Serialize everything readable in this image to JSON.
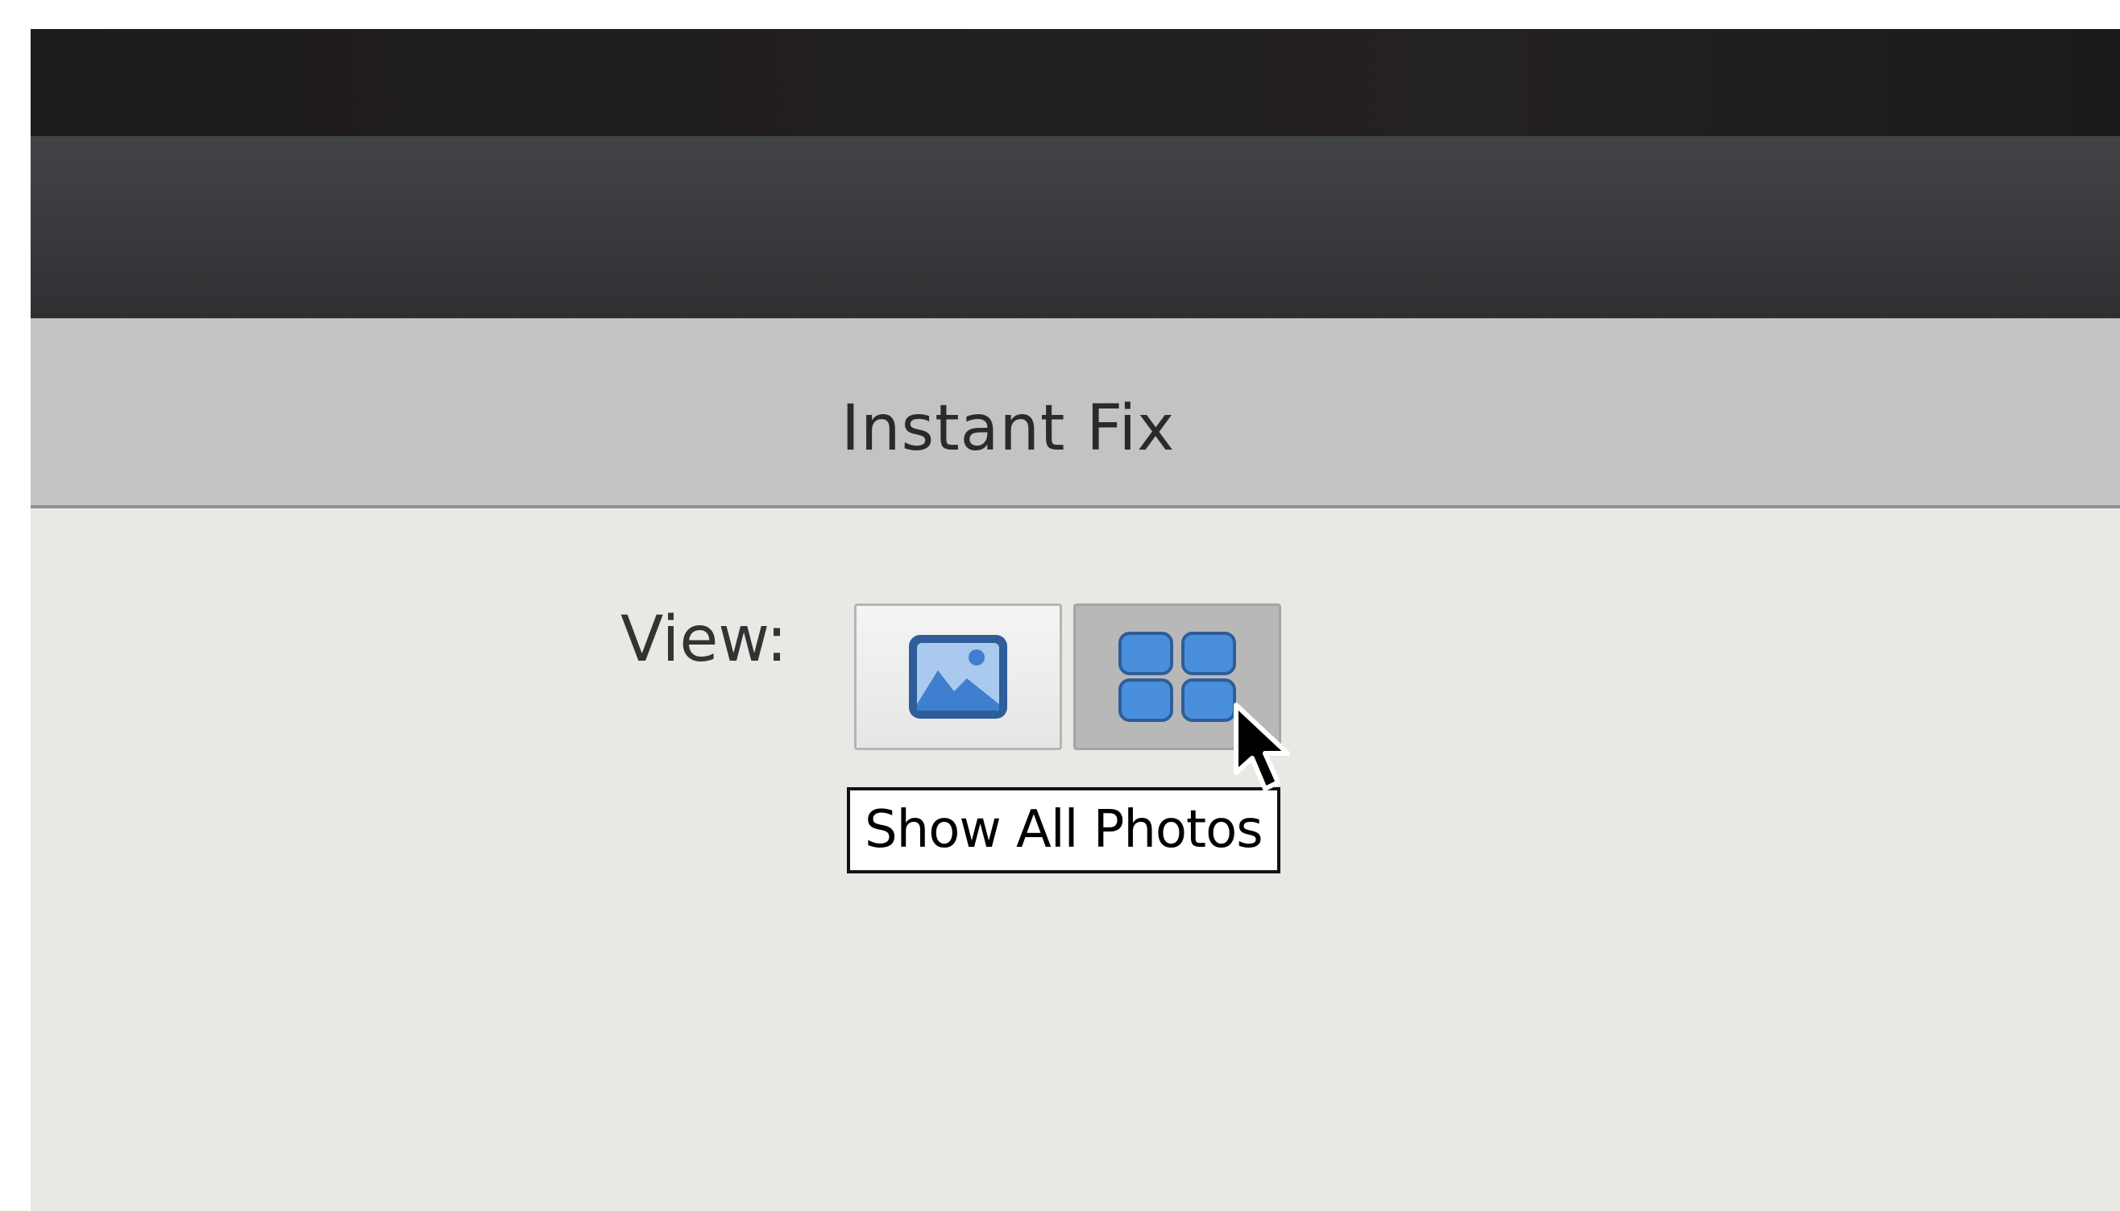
{
  "panel": {
    "title": "Instant Fix"
  },
  "view": {
    "label": "View:",
    "buttons": [
      {
        "name": "single-photo-view",
        "icon": "single-photo-icon",
        "selected": false
      },
      {
        "name": "grid-view",
        "icon": "grid-icon",
        "selected": true
      }
    ]
  },
  "tooltip": {
    "text": "Show All Photos"
  },
  "colors": {
    "icon_blue": "#4a8fdc",
    "icon_outline": "#2e5d99",
    "selected_button_bg": "#b8b8b8",
    "panel_header_bg": "#c3c3c3",
    "toolbar_bg": "#3a3b3e"
  },
  "cursor": {
    "icon": "arrow-pointer-icon"
  }
}
